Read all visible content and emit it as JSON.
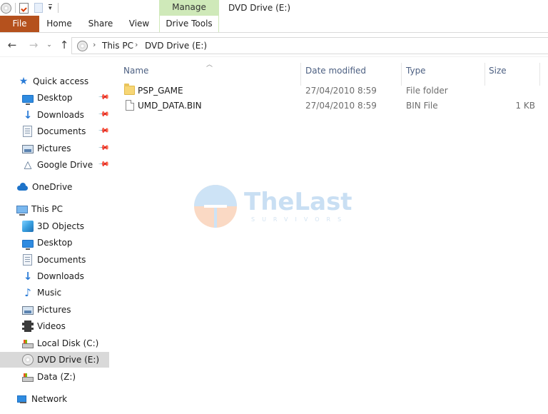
{
  "window": {
    "title": "DVD Drive (E:)",
    "contextual_group": "Manage"
  },
  "ribbon": {
    "tabs": [
      {
        "label": "File"
      },
      {
        "label": "Home"
      },
      {
        "label": "Share"
      },
      {
        "label": "View"
      },
      {
        "label": "Drive Tools"
      }
    ]
  },
  "address": {
    "crumbs": [
      "This PC",
      "DVD Drive (E:)"
    ]
  },
  "navpane": {
    "quick_access": {
      "label": "Quick access",
      "items": [
        {
          "label": "Desktop",
          "icon": "desktop-icon",
          "pinned": true
        },
        {
          "label": "Downloads",
          "icon": "downloads-icon",
          "pinned": true
        },
        {
          "label": "Documents",
          "icon": "documents-icon",
          "pinned": true
        },
        {
          "label": "Pictures",
          "icon": "pictures-icon",
          "pinned": true
        },
        {
          "label": "Google Drive",
          "icon": "google-drive-icon",
          "pinned": true
        }
      ]
    },
    "onedrive": {
      "label": "OneDrive"
    },
    "this_pc": {
      "label": "This PC",
      "items": [
        {
          "label": "3D Objects"
        },
        {
          "label": "Desktop"
        },
        {
          "label": "Documents"
        },
        {
          "label": "Downloads"
        },
        {
          "label": "Music"
        },
        {
          "label": "Pictures"
        },
        {
          "label": "Videos"
        },
        {
          "label": "Local Disk (C:)"
        },
        {
          "label": "DVD Drive (E:)",
          "selected": true
        },
        {
          "label": "Data (Z:)"
        }
      ]
    },
    "network": {
      "label": "Network"
    }
  },
  "content": {
    "columns": {
      "name": "Name",
      "date": "Date modified",
      "type": "Type",
      "size": "Size"
    },
    "files": [
      {
        "name": "PSP_GAME",
        "date": "27/04/2010 8:59",
        "type": "File folder",
        "size": "",
        "icon": "folder-icon"
      },
      {
        "name": "UMD_DATA.BIN",
        "date": "27/04/2010 8:59",
        "type": "BIN File",
        "size": "1 KB",
        "icon": "file-icon"
      }
    ]
  },
  "watermark": {
    "title": "TheLast",
    "subtitle": "SURVIVORS"
  },
  "colors": {
    "file_tab": "#b5511d",
    "manage_tab": "#cfe9b9",
    "selection": "#d9d9d9",
    "column_header_text": "#4d6082"
  }
}
